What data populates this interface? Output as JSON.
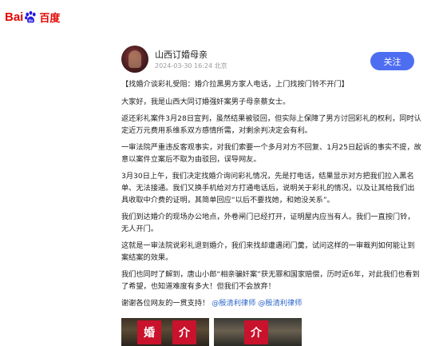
{
  "brand": {
    "logo_bai": "Bai",
    "logo_du": "du",
    "logo_cn": "百度"
  },
  "post": {
    "author": "山西订婚母亲",
    "timestamp": "2024-03-30 16:24",
    "location": "北京",
    "follow_label": "关注"
  },
  "content": {
    "lead": "【找婚介谈彩礼受阻：婚介拉黑男方家人电话，上门找按门铃不开门】",
    "p1": "大家好，我是山西大同订婚强奸案男子母亲蔡女士。",
    "p2": "返还彩礼案件3月28日宣判，虽然结果被驳回，但实际上保障了男方讨回彩礼的权利，同时认定近万元费用系维系双方感情所需，对剩余判决定会有利。",
    "p3": "一审法院严重违反客观事实，对我们索要一个多月对方不回复、1月25日起诉的事实不提，故意以案件立案后不取为由驳回，误导网友。",
    "p4": "3月30日上午，我们决定找婚介询问彩礼情况，先是打电话，结果显示对方把我们拉入黑名单、无法接通。我们又换手机给对方打通电话后，说明关于彩礼的情况，以及让其给我们出具收取中介费的证明，其简单回应“以后不要找她，和她没关系”。",
    "p5": "我们到达婚介的现场办公地点，外卷闸门已经打开，证明屋内应当有人。我们一直按门铃，无人开门。",
    "p6": "这就是一审法院说彩礼退到婚介，我们来找却遭遇闭门羹，试问这样的一审裁判如何能让到案结案的效果。",
    "p7": "我们也同时了解到，唐山小郎“相亲骗奸案”获无罪和国家赔偿，历时近6年，对此我们也看到了希望，也知道难度有多大！但我们不会放弃！",
    "thanks_prefix": "谢谢各位网友的一贯支持！",
    "mention_1": "@殷清利律师",
    "mention_2": "@殷清利律师"
  },
  "photos": {
    "sign_1": "婚",
    "sign_2": "介"
  },
  "colors": {
    "accent": "#4e6ef2",
    "brand_red": "#e10601",
    "mention": "#2c66c9"
  }
}
